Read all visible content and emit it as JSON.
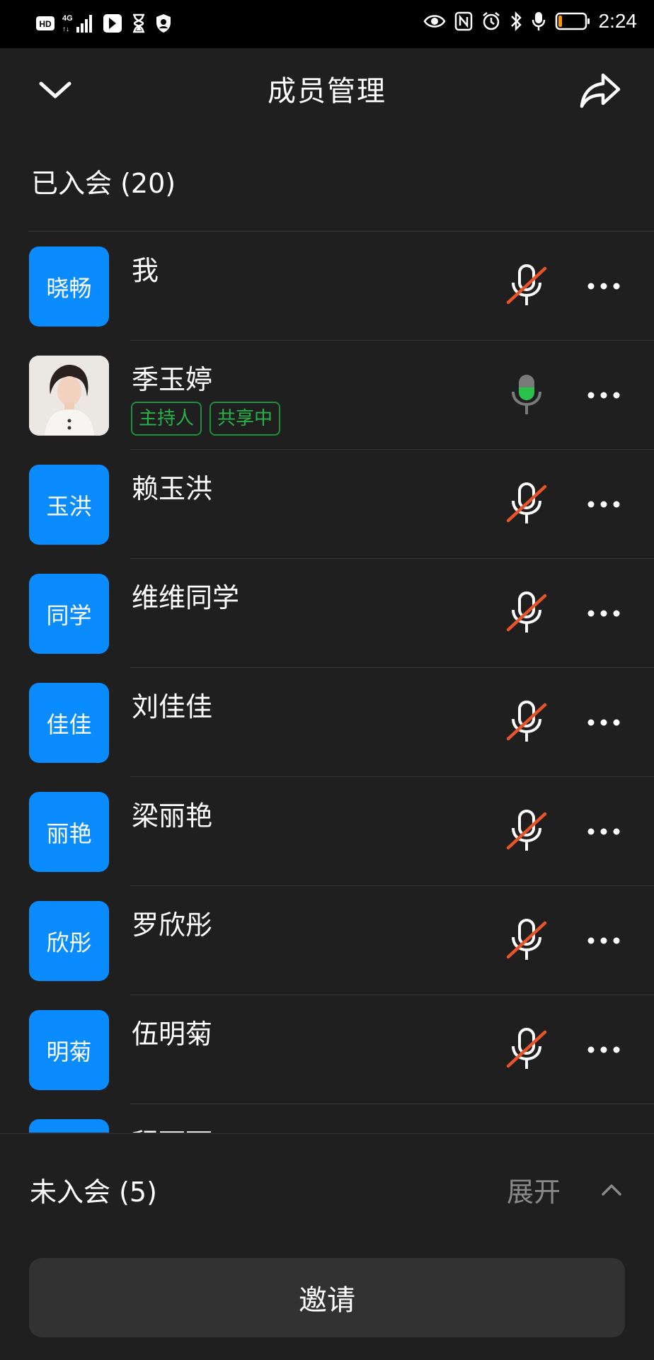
{
  "status_bar": {
    "left_icons": [
      "hd-icon",
      "signal-4g-icon",
      "app-notification-icon",
      "hourglass-icon",
      "shield-icon"
    ],
    "right_icons": [
      "eye-icon",
      "nfc-icon",
      "alarm-icon",
      "bluetooth-icon",
      "mic-icon",
      "battery-icon"
    ],
    "time": "2:24",
    "battery_level": 0.15
  },
  "header": {
    "title": "成员管理"
  },
  "joined": {
    "title": "已入会 (20)",
    "members": [
      {
        "avatar_text": "晓畅",
        "name": "我",
        "mic": "muted",
        "tags": []
      },
      {
        "avatar_text": "",
        "avatar_photo": true,
        "name": "季玉婷",
        "mic": "active",
        "tags": [
          "主持人",
          "共享中"
        ]
      },
      {
        "avatar_text": "玉洪",
        "name": "赖玉洪",
        "mic": "muted",
        "tags": []
      },
      {
        "avatar_text": "同学",
        "name": "维维同学",
        "mic": "muted",
        "tags": []
      },
      {
        "avatar_text": "佳佳",
        "name": "刘佳佳",
        "mic": "muted",
        "tags": []
      },
      {
        "avatar_text": "丽艳",
        "name": "梁丽艳",
        "mic": "muted",
        "tags": []
      },
      {
        "avatar_text": "欣彤",
        "name": "罗欣彤",
        "mic": "muted",
        "tags": []
      },
      {
        "avatar_text": "明菊",
        "name": "伍明菊",
        "mic": "muted",
        "tags": []
      },
      {
        "avatar_text": "",
        "name": "程丽丽",
        "mic": "muted",
        "tags": []
      }
    ]
  },
  "not_joined": {
    "title": "未入会 (5)",
    "expand_label": "展开"
  },
  "invite_button": "邀请",
  "colors": {
    "background": "#1f1f1f",
    "avatar_blue": "#0a8cff",
    "muted_slash": "#e8542a",
    "active_green": "#28c24a",
    "tag_green": "#28b34a"
  }
}
